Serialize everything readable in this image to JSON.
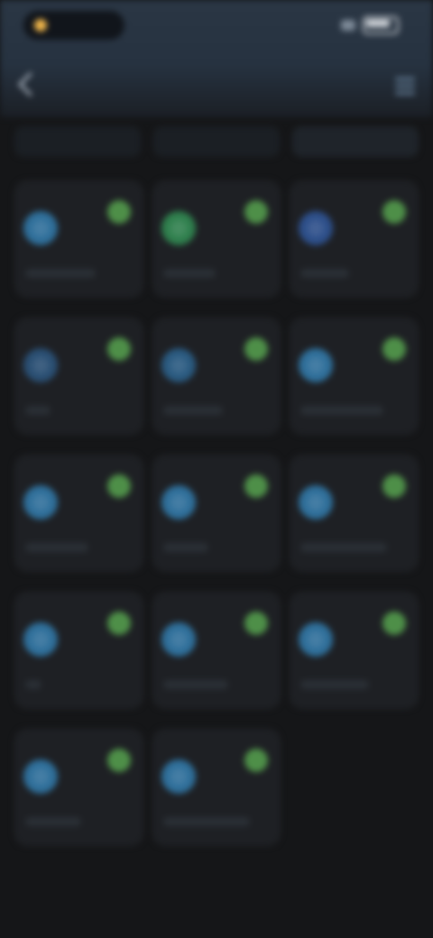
{
  "colors": {
    "header_top": "#2a3644",
    "header_bottom": "#1b1f25",
    "bg": "#151618",
    "tile_bg": "#1e2024",
    "avatar_blue": "#2f6f9a",
    "status_green": "#4e8f48"
  },
  "statusbar": {
    "left_app": "",
    "clock": "",
    "icons": [
      "wifi-icon",
      "battery-icon"
    ]
  },
  "appbar": {
    "title": "",
    "back_icon": "back-arrow-icon",
    "menu_icon": "menu-icon"
  },
  "filters": [
    {
      "label": ""
    },
    {
      "label": ""
    },
    {
      "label": ""
    }
  ],
  "grid": {
    "items": [
      {
        "name": "",
        "status": "online"
      },
      {
        "name": "",
        "status": "online"
      },
      {
        "name": "",
        "status": "online"
      },
      {
        "name": "",
        "status": "online"
      },
      {
        "name": "",
        "status": "online"
      },
      {
        "name": "",
        "status": "online"
      },
      {
        "name": "",
        "status": "online"
      },
      {
        "name": "",
        "status": "online"
      },
      {
        "name": "",
        "status": "online"
      },
      {
        "name": "",
        "status": "online"
      },
      {
        "name": "",
        "status": "online"
      },
      {
        "name": "",
        "status": "online"
      },
      {
        "name": "",
        "status": "online"
      },
      {
        "name": "",
        "status": "online"
      }
    ]
  }
}
